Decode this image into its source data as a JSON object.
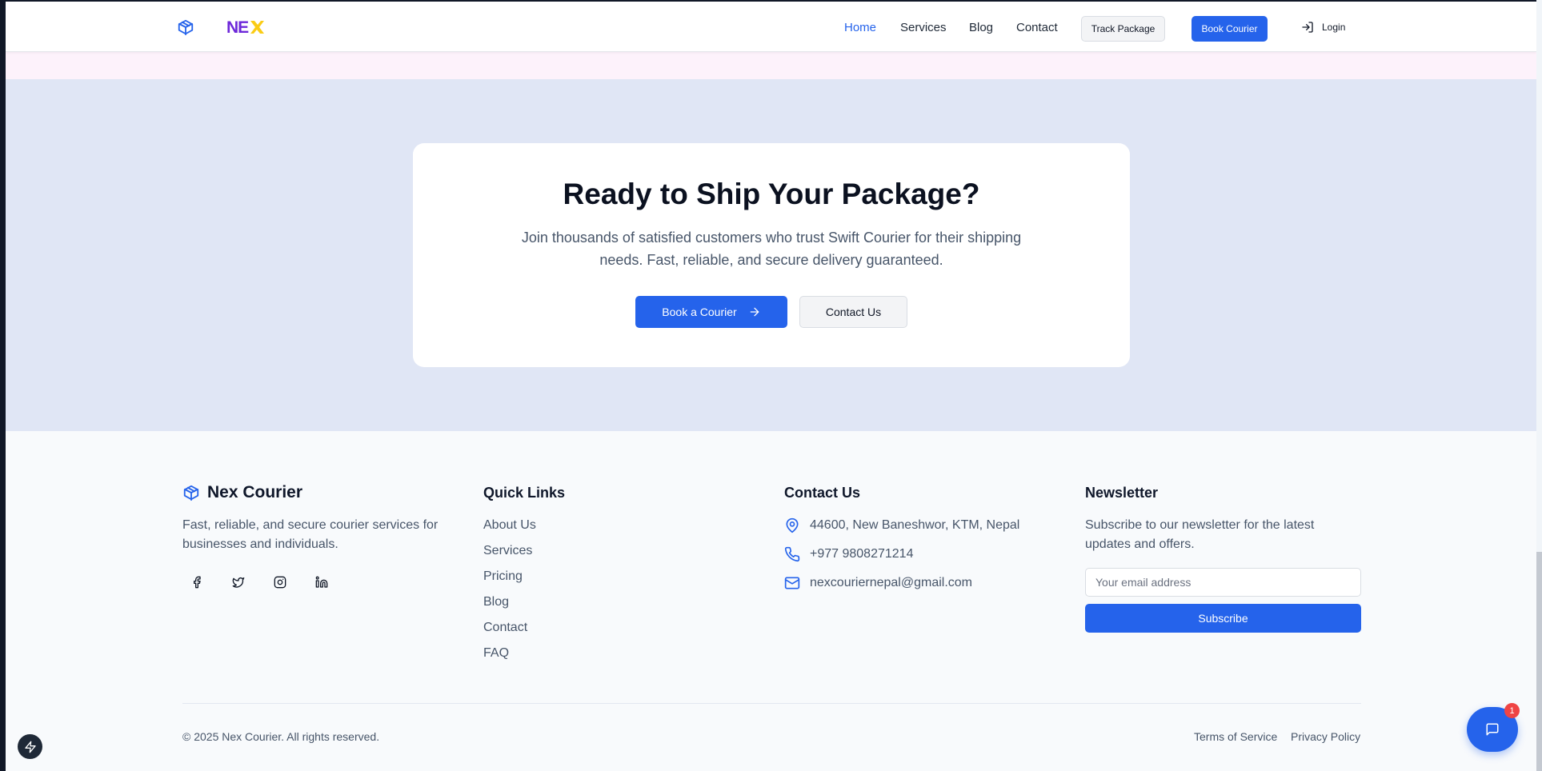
{
  "header": {
    "logo_text": "NEX",
    "nav": [
      {
        "label": "Home",
        "active": true
      },
      {
        "label": "Services",
        "active": false
      },
      {
        "label": "Blog",
        "active": false
      },
      {
        "label": "Contact",
        "active": false
      }
    ],
    "track_label": "Track Package",
    "book_label": "Book Courier",
    "login_label": "Login"
  },
  "cta": {
    "title": "Ready to Ship Your Package?",
    "description": "Join thousands of satisfied customers who trust Swift Courier for their shipping needs. Fast, reliable, and secure delivery guaranteed.",
    "primary_label": "Book a Courier",
    "secondary_label": "Contact Us"
  },
  "footer": {
    "brand_name": "Nex Courier",
    "brand_tagline": "Fast, reliable, and secure courier services for businesses and individuals.",
    "social": [
      "facebook-icon",
      "twitter-icon",
      "instagram-icon",
      "linkedin-icon"
    ],
    "quick_links_title": "Quick Links",
    "quick_links": [
      "About Us",
      "Services",
      "Pricing",
      "Blog",
      "Contact",
      "FAQ"
    ],
    "contact_title": "Contact Us",
    "contact": {
      "address": "44600, New Baneshwor, KTM, Nepal",
      "phone": "+977 9808271214",
      "email": "nexcouriernepal@gmail.com"
    },
    "newsletter_title": "Newsletter",
    "newsletter_desc": "Subscribe to our newsletter for the latest updates and offers.",
    "email_placeholder": "Your email address",
    "subscribe_label": "Subscribe",
    "copyright": "© 2025 Nex Courier. All rights reserved.",
    "terms_label": "Terms of Service",
    "privacy_label": "Privacy Policy"
  },
  "chat_badge": "1",
  "colors": {
    "accent": "#2563eb",
    "cta_bg": "#e0e6f5",
    "badge": "#ef4444"
  }
}
